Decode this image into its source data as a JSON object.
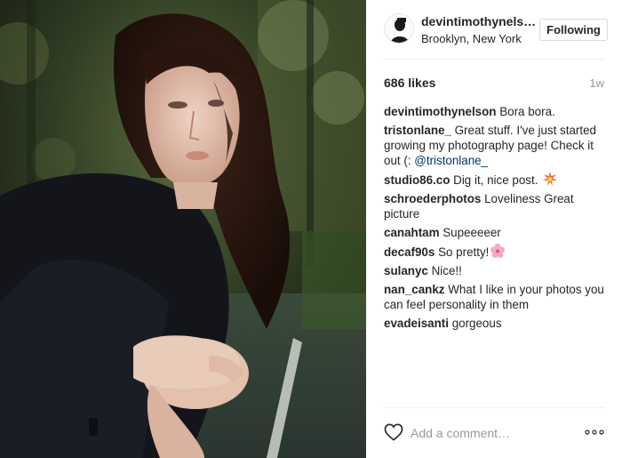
{
  "post": {
    "author": "devintimothynels…",
    "location": "Brooklyn, New York",
    "follow_label": "Following",
    "likes": "686 likes",
    "time_ago": "1w",
    "photo_description": "Portrait of a woman with long wavy brown hair in a dark coat, sitting outdoors with trees behind her",
    "avatar_icon": "avatar-silhouette"
  },
  "comments": [
    {
      "user": "devintimothynelson",
      "text": "Bora bora."
    },
    {
      "user": "tristonlane_",
      "text": "Great stuff. I've just started growing my photography page! Check it out (: ",
      "mention": "@tristonlane_"
    },
    {
      "user": "studio86.co",
      "text": "Dig it, nice post.",
      "emoji": "collision"
    },
    {
      "user": "schroederphotos",
      "text": "Loveliness Great picture"
    },
    {
      "user": "canahtam",
      "text": "Supeeeeer"
    },
    {
      "user": "decaf90s",
      "text": "So pretty!",
      "emoji": "cherry-blossom"
    },
    {
      "user": "sulanyc",
      "text": "Nice!!"
    },
    {
      "user": "nan_cankz",
      "text": "What I like in your photos you can feel personality in them"
    },
    {
      "user": "evadeisanti",
      "text": "gorgeous"
    }
  ],
  "footer": {
    "comment_placeholder": "Add a comment…",
    "like_icon": "heart-outline",
    "more_icon": "more-dots"
  },
  "colors": {
    "text": "#262626",
    "muted": "#999999",
    "link": "#003569",
    "border": "#dbdbdb"
  }
}
